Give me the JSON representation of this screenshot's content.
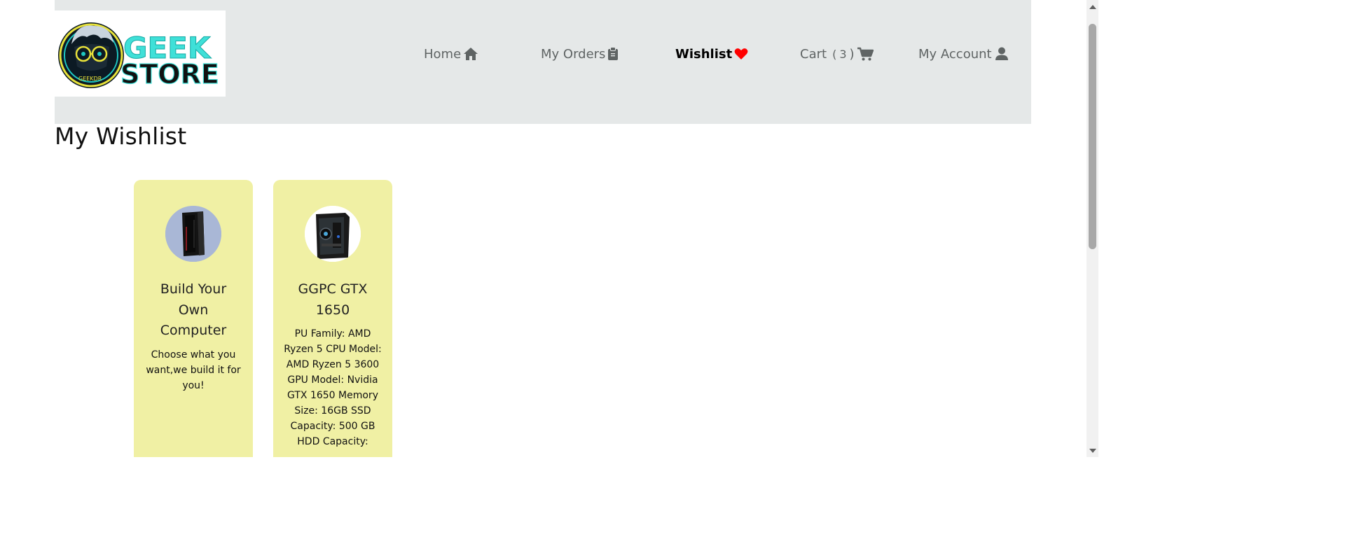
{
  "logo": {
    "line1": "GEEK",
    "line2": "STORE",
    "badge": "GEEKDR"
  },
  "nav": {
    "home": "Home",
    "orders": "My Orders",
    "wishlist": "Wishlist",
    "cart_label": "Cart",
    "cart_open": "(",
    "cart_count": "3",
    "cart_close": ")",
    "account": "My Account",
    "active": "wishlist"
  },
  "page": {
    "title": "My Wishlist"
  },
  "wishlist": [
    {
      "name": "Build Your Own Computer",
      "description": "Choose what you want,we build it for you!",
      "image_bg": "#a9b7d6"
    },
    {
      "name": "GGPC GTX 1650",
      "description": "PU Family: AMD Ryzen 5 CPU Model: AMD Ryzen 5 3600 GPU Model: Nvidia GTX 1650 Memory Size: 16GB SSD Capacity: 500 GB HDD Capacity:",
      "image_bg": "#ffffff"
    }
  ],
  "colors": {
    "header_bg": "#e5e8e8",
    "card_bg": "#f0f0a4",
    "nav_text": "#5f6464",
    "heart": "#ff0000",
    "logo_cyan": "#3fe0d8"
  },
  "icons": {
    "home": "home-icon",
    "orders": "clipboard-icon",
    "wishlist": "heart-icon",
    "cart": "cart-icon",
    "account": "user-icon"
  }
}
